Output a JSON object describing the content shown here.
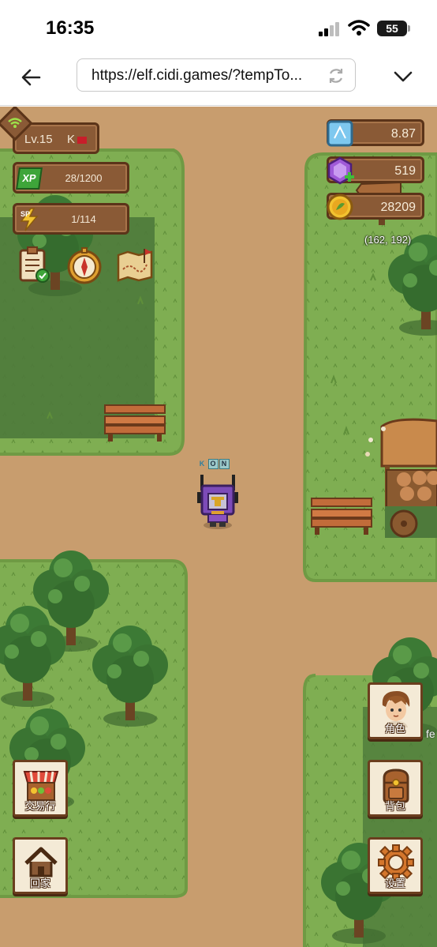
{
  "status_bar": {
    "time": "16:35",
    "battery": "55"
  },
  "browser": {
    "url": "https://elf.cidi.games/?tempTo..."
  },
  "hud": {
    "level": "Lv.15",
    "player_initial": "K",
    "xp": "28/1200",
    "xp_badge": "XP",
    "sp": "1/114",
    "sp_badge": "SP",
    "tools": [
      "quest-list-icon",
      "compass-icon",
      "treasure-map-icon"
    ]
  },
  "resources": {
    "crystal": "8.87",
    "gem": "519",
    "coin": "28209",
    "coordinates": "(162, 192)"
  },
  "player": {
    "name_letters": [
      "K",
      "O",
      "N"
    ]
  },
  "buttons": {
    "character": "角色",
    "backpack": "背包",
    "settings": "设置",
    "trading": "交易行",
    "home": "回家"
  },
  "offscreen_text": "fe",
  "colors": {
    "grass": "#7fae52",
    "dark_grass": "#4e7a3b",
    "path": "#c89d6e",
    "panel": "#8a5a36",
    "panel_border": "#5b3419"
  }
}
